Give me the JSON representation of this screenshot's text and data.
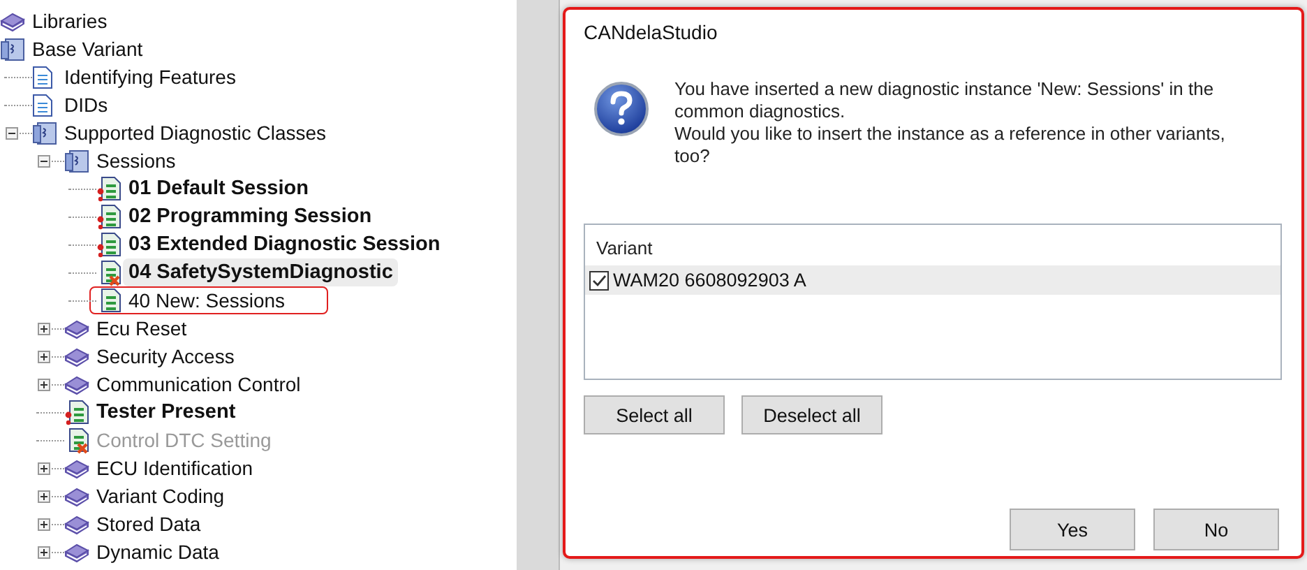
{
  "tree": [
    {
      "label": "Libraries",
      "kind": "book",
      "bold": false,
      "disabled": false,
      "selected": false,
      "annotated": false
    },
    {
      "label": "Base Variant",
      "kind": "binder",
      "bold": false,
      "disabled": false,
      "selected": false,
      "annotated": false,
      "children": [
        {
          "label": "Identifying Features",
          "kind": "document",
          "bold": false,
          "disabled": false,
          "selected": false,
          "annotated": false
        },
        {
          "label": "DIDs",
          "kind": "document",
          "bold": false,
          "disabled": false,
          "selected": false,
          "annotated": false
        },
        {
          "label": "Supported Diagnostic Classes",
          "kind": "binder",
          "expanded": true,
          "bold": false,
          "disabled": false,
          "selected": false,
          "annotated": false,
          "children": [
            {
              "label": "Sessions",
              "kind": "binder",
              "expanded": true,
              "bold": false,
              "disabled": false,
              "selected": false,
              "annotated": false,
              "children": [
                {
                  "label": "01 Default Session",
                  "kind": "service",
                  "error": true,
                  "deleted": false,
                  "bold": true,
                  "disabled": false,
                  "selected": false,
                  "annotated": false
                },
                {
                  "label": "02 Programming Session",
                  "kind": "service",
                  "error": true,
                  "deleted": false,
                  "bold": true,
                  "disabled": false,
                  "selected": false,
                  "annotated": false
                },
                {
                  "label": "03 Extended Diagnostic Session",
                  "kind": "service",
                  "error": true,
                  "deleted": false,
                  "bold": true,
                  "disabled": false,
                  "selected": false,
                  "annotated": false
                },
                {
                  "label": "04 SafetySystemDiagnostic",
                  "kind": "service",
                  "error": false,
                  "deleted": true,
                  "bold": true,
                  "disabled": false,
                  "selected": true,
                  "annotated": false
                },
                {
                  "label": "40 New: Sessions",
                  "kind": "service",
                  "error": false,
                  "deleted": false,
                  "bold": false,
                  "disabled": false,
                  "selected": false,
                  "annotated": true
                }
              ]
            },
            {
              "label": "Ecu Reset",
              "kind": "book",
              "expanded": false,
              "bold": false,
              "disabled": false,
              "selected": false,
              "annotated": false
            },
            {
              "label": "Security Access",
              "kind": "book",
              "expanded": false,
              "bold": false,
              "disabled": false,
              "selected": false,
              "annotated": false
            },
            {
              "label": "Communication Control",
              "kind": "book",
              "expanded": false,
              "bold": false,
              "disabled": false,
              "selected": false,
              "annotated": false
            },
            {
              "label": "Tester Present",
              "kind": "service",
              "error": true,
              "deleted": false,
              "bold": true,
              "disabled": false,
              "selected": false,
              "annotated": false
            },
            {
              "label": "Control DTC Setting",
              "kind": "service",
              "error": false,
              "deleted": true,
              "bold": false,
              "disabled": true,
              "selected": false,
              "annotated": false
            },
            {
              "label": "ECU Identification",
              "kind": "book",
              "expanded": false,
              "bold": false,
              "disabled": false,
              "selected": false,
              "annotated": false
            },
            {
              "label": "Variant Coding",
              "kind": "book",
              "expanded": false,
              "bold": false,
              "disabled": false,
              "selected": false,
              "annotated": false
            },
            {
              "label": "Stored Data",
              "kind": "book",
              "expanded": false,
              "bold": false,
              "disabled": false,
              "selected": false,
              "annotated": false
            },
            {
              "label": "Dynamic Data",
              "kind": "book",
              "expanded": false,
              "bold": false,
              "disabled": false,
              "selected": false,
              "annotated": false
            }
          ]
        }
      ]
    }
  ],
  "dialog": {
    "title": "CANdelaStudio",
    "annotated": true,
    "message": [
      "You have inserted a new diagnostic instance 'New: Sessions' in the common diagnostics.",
      "Would you like to insert the instance as a reference in other variants, too?"
    ],
    "list": {
      "column": "Variant",
      "rows": [
        {
          "label": "WAM20 6608092903  A",
          "checked": true,
          "selected": true
        }
      ]
    },
    "list_buttons": [
      "Select all",
      "Deselect all"
    ],
    "buttons": [
      "Yes",
      "No"
    ]
  }
}
